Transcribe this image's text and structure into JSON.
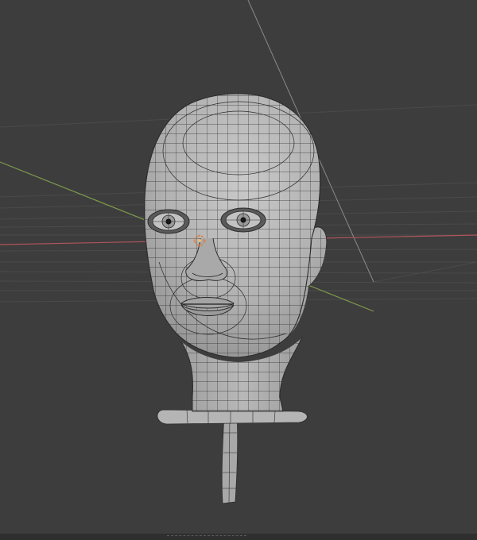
{
  "app": {
    "name": "",
    "view": ""
  },
  "viewport": {
    "background": "#3d3d3d",
    "grid_color": "#4a4a4a",
    "x_axis_color": "#b0545c",
    "y_axis_color": "#7e9a4a",
    "light_line_color": "#8a8a8a"
  },
  "mesh": {
    "object": "head-model",
    "wire_color": "#2b2b2b",
    "surface_color": "#b8b8b8",
    "shading_color": "#8f8f8f"
  },
  "origin_marker": {
    "color": "#e07a3a",
    "icon": "crosshair-icon"
  }
}
